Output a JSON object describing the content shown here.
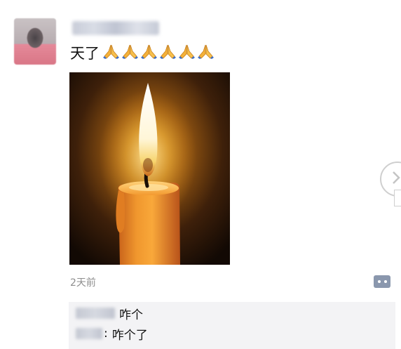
{
  "post": {
    "text": "天了",
    "reaction_emojis": [
      "pray-emoji",
      "pray-emoji",
      "pray-emoji",
      "pray-emoji",
      "pray-emoji",
      "pray-emoji"
    ],
    "image": "candle-flame-image",
    "time": "2天前"
  },
  "comments": [
    {
      "text": "咋个"
    },
    {
      "separator": ":",
      "text": "咋个了"
    }
  ],
  "colors": {
    "time_gray": "#8e8e8e",
    "comment_bg": "#f3f3f5",
    "more_button": "#8a97ad"
  }
}
